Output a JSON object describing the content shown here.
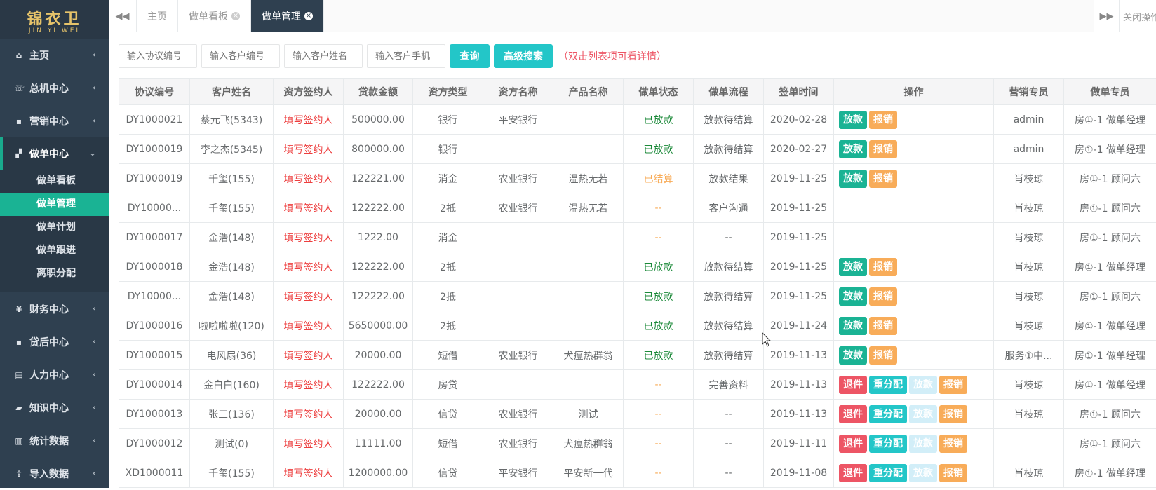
{
  "logo": {
    "main": "锦衣卫",
    "sub": "JIN YI WEI"
  },
  "sidebar": {
    "items_top": [
      {
        "label": "主页",
        "icon": "home-icon",
        "glyph": "⌂"
      },
      {
        "label": "总机中心",
        "icon": "phone-icon",
        "glyph": "☏"
      },
      {
        "label": "营销中心",
        "icon": "users-icon",
        "glyph": "▪"
      }
    ],
    "active_group": {
      "label": "做单中心",
      "icon": "sitemap-icon",
      "glyph": "▞",
      "chevron": "⌄"
    },
    "subitems": [
      "做单看板",
      "做单管理",
      "做单计划",
      "做单跟进",
      "离职分配"
    ],
    "items_bottom": [
      {
        "label": "财务中心",
        "icon": "yen-icon",
        "glyph": "¥"
      },
      {
        "label": "贷后中心",
        "icon": "user-plus-icon",
        "glyph": "▪"
      },
      {
        "label": "人力中心",
        "icon": "id-card-icon",
        "glyph": "▤"
      },
      {
        "label": "知识中心",
        "icon": "book-icon",
        "glyph": "▰"
      },
      {
        "label": "统计数据",
        "icon": "bar-chart-icon",
        "glyph": "▥"
      },
      {
        "label": "导入数据",
        "icon": "upload-icon",
        "glyph": "⇪"
      }
    ],
    "chevron": "‹"
  },
  "tabbar": {
    "left_arrow": "◀◀",
    "tabs": [
      {
        "label": "主页",
        "closable": false
      },
      {
        "label": "做单看板",
        "closable": true
      },
      {
        "label": "做单管理",
        "closable": true,
        "active": true
      }
    ],
    "close_glyph": "×",
    "right_arrow": "▶▶",
    "close_ops": "关闭操作"
  },
  "search": {
    "placeholders": [
      "输入协议编号",
      "输入客户编号",
      "输入客户姓名",
      "输入客户手机"
    ],
    "query_label": "查询",
    "advanced_label": "高级搜索",
    "hint": "（双击列表项可看详情）"
  },
  "table": {
    "headers": [
      "协议编号",
      "客户姓名",
      "资方签约人",
      "贷款金额",
      "资方类型",
      "资方名称",
      "产品名称",
      "做单状态",
      "做单流程",
      "签单时间",
      "操作",
      "营销专员",
      "做单专员"
    ],
    "sign_label": "填写签约人",
    "btn_labels": {
      "fang": "放款",
      "bao": "报销",
      "tui": "退件",
      "chong": "重分配"
    },
    "rows": [
      {
        "id": "DY1000021",
        "name": "蔡元飞(5343)",
        "amount": "500000.00",
        "type": "银行",
        "bank": "平安银行",
        "product": "",
        "status": "已放款",
        "status_color": "green",
        "flow": "放款待结算",
        "date": "2020-02-28",
        "ops": [
          "fang",
          "bao"
        ],
        "marketing": "admin",
        "maker": "房①-1 做单经理"
      },
      {
        "id": "DY1000019",
        "name": "李之杰(5345)",
        "amount": "800000.00",
        "type": "银行",
        "bank": "",
        "product": "",
        "status": "已放款",
        "status_color": "green",
        "flow": "放款待结算",
        "date": "2020-02-27",
        "ops": [
          "fang",
          "bao"
        ],
        "marketing": "admin",
        "maker": "房①-1 做单经理"
      },
      {
        "id": "DY1000019",
        "name": "千玺(155)",
        "amount": "122221.00",
        "type": "消金",
        "bank": "农业银行",
        "product": "温热无若",
        "status": "已结算",
        "status_color": "orange",
        "flow": "放款结果",
        "date": "2019-11-25",
        "ops": [
          "fang",
          "bao"
        ],
        "marketing": "肖枝琼",
        "maker": "房①-1 顾问六"
      },
      {
        "id": "DY10000...",
        "name": "千玺(155)",
        "amount": "122222.00",
        "type": "2抵",
        "bank": "农业银行",
        "product": "温热无若",
        "status": "--",
        "status_color": "orange",
        "flow": "客户沟通",
        "date": "2019-11-25",
        "ops": [],
        "marketing": "肖枝琼",
        "maker": "房①-1 顾问六"
      },
      {
        "id": "DY1000017",
        "name": "金浩(148)",
        "amount": "1222.00",
        "type": "消金",
        "bank": "",
        "product": "",
        "status": "--",
        "status_color": "orange",
        "flow": "--",
        "date": "2019-11-25",
        "ops": [],
        "marketing": "肖枝琼",
        "maker": "房①-1 顾问六"
      },
      {
        "id": "DY1000018",
        "name": "金浩(148)",
        "amount": "122222.00",
        "type": "2抵",
        "bank": "",
        "product": "",
        "status": "已放款",
        "status_color": "green",
        "flow": "放款待结算",
        "date": "2019-11-25",
        "ops": [
          "fang",
          "bao"
        ],
        "marketing": "肖枝琼",
        "maker": "房①-1 做单经理"
      },
      {
        "id": "DY10000...",
        "name": "金浩(148)",
        "amount": "122222.00",
        "type": "2抵",
        "bank": "",
        "product": "",
        "status": "已放款",
        "status_color": "green",
        "flow": "放款待结算",
        "date": "2019-11-25",
        "ops": [
          "fang",
          "bao"
        ],
        "marketing": "肖枝琼",
        "maker": "房①-1 顾问六"
      },
      {
        "id": "DY1000016",
        "name": "啦啦啦啦(120)",
        "amount": "5650000.00",
        "type": "2抵",
        "bank": "",
        "product": "",
        "status": "已放款",
        "status_color": "green",
        "flow": "放款待结算",
        "date": "2019-11-24",
        "ops": [
          "fang",
          "bao"
        ],
        "marketing": "肖枝琼",
        "maker": "房①-1 做单经理"
      },
      {
        "id": "DY1000015",
        "name": "电风扇(36)",
        "amount": "20000.00",
        "type": "短借",
        "bank": "农业银行",
        "product": "犬瘟热群翁",
        "status": "已放款",
        "status_color": "green",
        "flow": "放款待结算",
        "date": "2019-11-13",
        "ops": [
          "fang",
          "bao"
        ],
        "marketing": "服务①中...",
        "maker": "房①-1 做单经理"
      },
      {
        "id": "DY1000014",
        "name": "金白白(160)",
        "amount": "122222.00",
        "type": "房贷",
        "bank": "",
        "product": "",
        "status": "--",
        "status_color": "orange",
        "flow": "完善资料",
        "date": "2019-11-13",
        "ops": [
          "tui",
          "chong",
          "fangdis",
          "bao"
        ],
        "marketing": "肖枝琼",
        "maker": "房①-1 做单经理"
      },
      {
        "id": "DY1000013",
        "name": "张三(136)",
        "amount": "20000.00",
        "type": "信贷",
        "bank": "农业银行",
        "product": "测试",
        "status": "--",
        "status_color": "orange",
        "flow": "--",
        "date": "2019-11-13",
        "ops": [
          "tui",
          "chong",
          "fangdis",
          "bao"
        ],
        "marketing": "肖枝琼",
        "maker": "房①-1 顾问六"
      },
      {
        "id": "DY1000012",
        "name": "测试(0)",
        "amount": "11111.00",
        "type": "短借",
        "bank": "农业银行",
        "product": "犬瘟热群翁",
        "status": "--",
        "status_color": "orange",
        "flow": "--",
        "date": "2019-11-11",
        "ops": [
          "tui",
          "chong",
          "fangdis",
          "bao"
        ],
        "marketing": "",
        "maker": "房①-1 顾问六"
      },
      {
        "id": "XD1000011",
        "name": "千玺(155)",
        "amount": "1200000.00",
        "type": "信贷",
        "bank": "平安银行",
        "product": "平安新一代",
        "status": "--",
        "status_color": "orange",
        "flow": "--",
        "date": "2019-11-08",
        "ops": [
          "tui",
          "chong",
          "fangdis",
          "bao"
        ],
        "marketing": "肖枝琼",
        "maker": "房①-1 做单经理"
      }
    ]
  }
}
